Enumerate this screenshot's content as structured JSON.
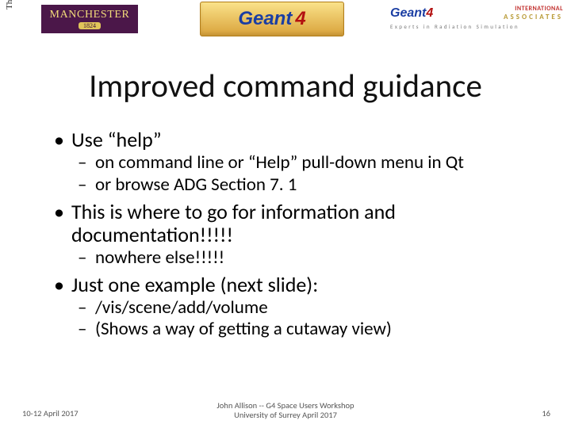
{
  "header": {
    "uom_vertical": "The University of Manchester",
    "uom_badge_top": "MANCHESTER",
    "uom_badge_year": "1824",
    "center_logo_text": "Geant",
    "center_logo_num": "4",
    "assoc_logo_text": "Geant",
    "assoc_logo_num": "4",
    "assoc_word": "ASSOCIATES",
    "assoc_intl": "INTERNATIONAL",
    "assoc_sub": "Experts in Radiation Simulation"
  },
  "title": "Improved command guidance",
  "bullets": {
    "b1": "Use “help”",
    "b1a": "on command line or “Help” pull-down menu in Qt",
    "b1b": "or browse ADG Section 7. 1",
    "b2": "This is where to go for information and documentation!!!!!",
    "b2a": "nowhere else!!!!!",
    "b3": "Just one example (next slide):",
    "b3a": "/vis/scene/add/volume",
    "b3b": "(Shows a way of getting a cutaway view)"
  },
  "footer": {
    "date": "10-12 April 2017",
    "center_line1": "John Allison -- G4 Space Users Workshop",
    "center_line2": "University of Surrey April 2017",
    "page": "16"
  }
}
